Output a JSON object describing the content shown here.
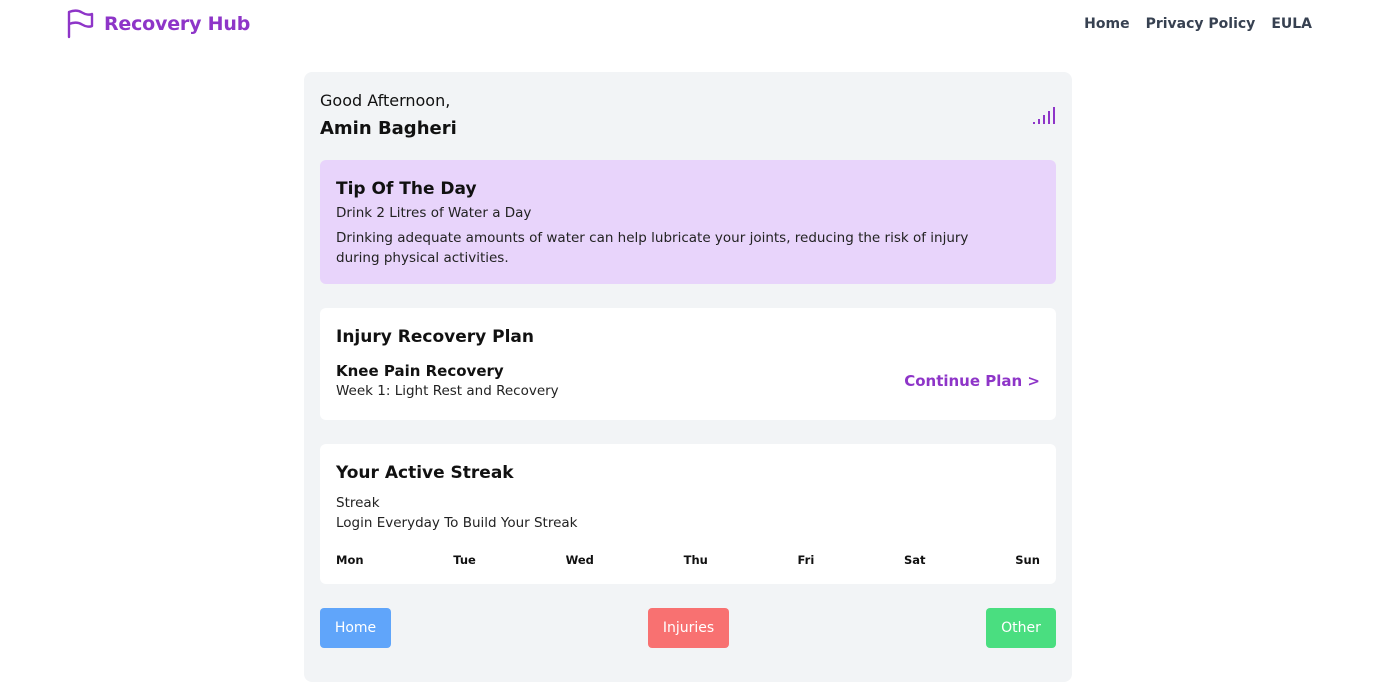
{
  "brand": {
    "name": "Recovery Hub",
    "icon": "flag-icon",
    "color": "#8e35c8"
  },
  "nav": {
    "home": "Home",
    "privacy": "Privacy Policy",
    "eula": "EULA"
  },
  "header": {
    "greeting": "Good Afternoon,",
    "username": "Amin Bagheri",
    "icon": "signal-bars-icon"
  },
  "tip": {
    "title": "Tip Of The Day",
    "subtitle": "Drink 2 Litres of Water a Day",
    "body": "Drinking adequate amounts of water can help lubricate your joints, reducing the risk of injury during physical activities.",
    "background": "#e8d4fb"
  },
  "plan": {
    "title": "Injury Recovery Plan",
    "name": "Knee Pain Recovery",
    "week": "Week 1: Light Rest and Recovery",
    "continue_label": "Continue Plan >"
  },
  "streak": {
    "title": "Your Active Streak",
    "label": "Streak",
    "hint": "Login Everyday To Build Your Streak",
    "days": [
      "Mon",
      "Tue",
      "Wed",
      "Thu",
      "Fri",
      "Sat",
      "Sun"
    ]
  },
  "bottom_nav": {
    "home": {
      "label": "Home",
      "color": "#60a5fa"
    },
    "injuries": {
      "label": "Injuries",
      "color": "#f87171"
    },
    "other": {
      "label": "Other",
      "color": "#4ade80"
    }
  }
}
